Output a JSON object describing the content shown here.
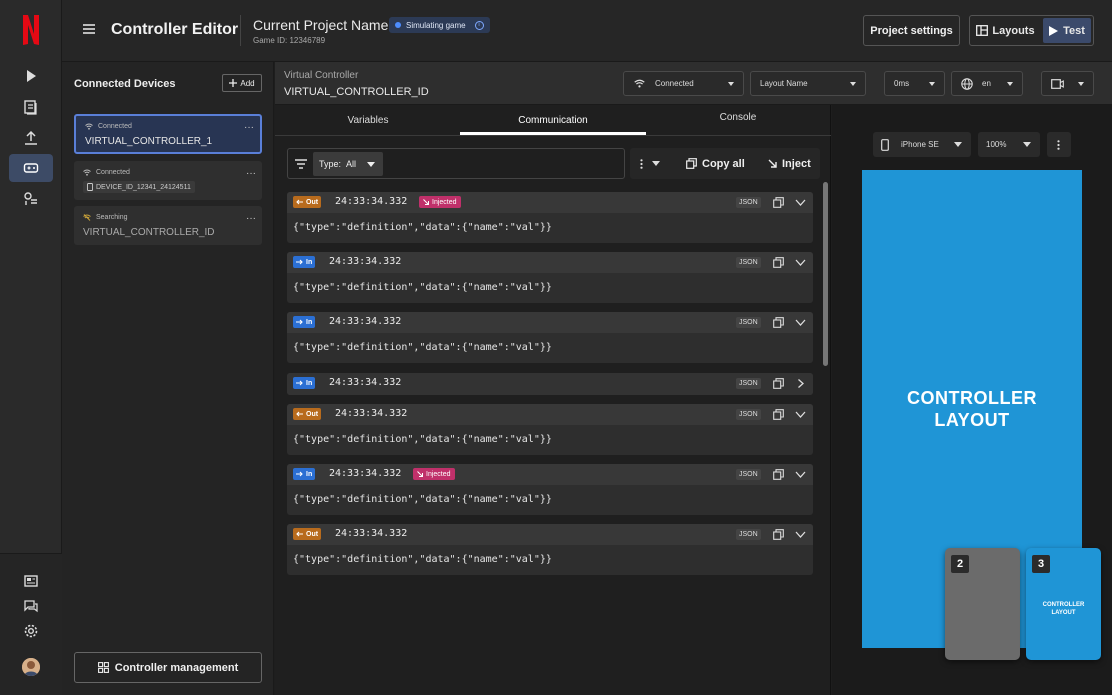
{
  "header": {
    "app_title": "Controller Editor",
    "project_name": "Current Project Name",
    "game_id": "Game ID: 12346789",
    "badge": "Simulating game",
    "project_settings": "Project settings",
    "layouts": "Layouts",
    "test": "Test"
  },
  "devices": {
    "title": "Connected Devices",
    "add": "Add",
    "items": [
      {
        "status": "Connected",
        "name": "VIRTUAL_CONTROLLER_1"
      },
      {
        "status": "Connected",
        "chip": "DEVICE_ID_12341_24124511"
      },
      {
        "status": "Searching",
        "name": "VIRTUAL_CONTROLLER_ID"
      }
    ],
    "management": "Controller management"
  },
  "vc": {
    "label": "Virtual Controller",
    "id": "VIRTUAL_CONTROLLER_ID",
    "connection": "Connected",
    "layout": "Layout Name",
    "latency": "0ms",
    "language": "en"
  },
  "comm": {
    "tabs": [
      "Variables",
      "Communication",
      "Console"
    ],
    "filter_label": "Type:",
    "filter_value": "All",
    "copy_all": "Copy all",
    "inject": "Inject",
    "messages": [
      {
        "dir": "Out",
        "time": "24:33:34.332",
        "injected": "Injected",
        "format": "JSON",
        "payload": "{\"type\":\"definition\",\"data\":{\"name\":\"val\"}}"
      },
      {
        "dir": "In",
        "time": "24:33:34.332",
        "format": "JSON",
        "payload": "{\"type\":\"definition\",\"data\":{\"name\":\"val\"}}"
      },
      {
        "dir": "In",
        "time": "24:33:34.332",
        "format": "JSON",
        "payload": "{\"type\":\"definition\",\"data\":{\"name\":\"val\"}}"
      },
      {
        "dir": "In",
        "time": "24:33:34.332",
        "format": "JSON"
      },
      {
        "dir": "Out",
        "time": "24:33:34.332",
        "format": "JSON",
        "payload": "{\"type\":\"definition\",\"data\":{\"name\":\"val\"}}"
      },
      {
        "dir": "In",
        "time": "24:33:34.332",
        "injected": "Injected",
        "format": "JSON",
        "payload": "{\"type\":\"definition\",\"data\":{\"name\":\"val\"}}"
      },
      {
        "dir": "Out",
        "time": "24:33:34.332",
        "format": "JSON",
        "payload": "{\"type\":\"definition\",\"data\":{\"name\":\"val\"}}"
      }
    ]
  },
  "preview": {
    "device": "iPhone SE",
    "zoom": "100%",
    "layout_text": "CONTROLLER LAYOUT",
    "thumbs": [
      {
        "num": "2"
      },
      {
        "num": "3",
        "label": "CONTROLLER LAYOUT"
      }
    ]
  },
  "colors": {
    "accent": "#3b4a6b",
    "out": "#b86b1d",
    "in": "#2b6fd3",
    "injected": "#c0306a",
    "layout": "#1f95d6"
  }
}
